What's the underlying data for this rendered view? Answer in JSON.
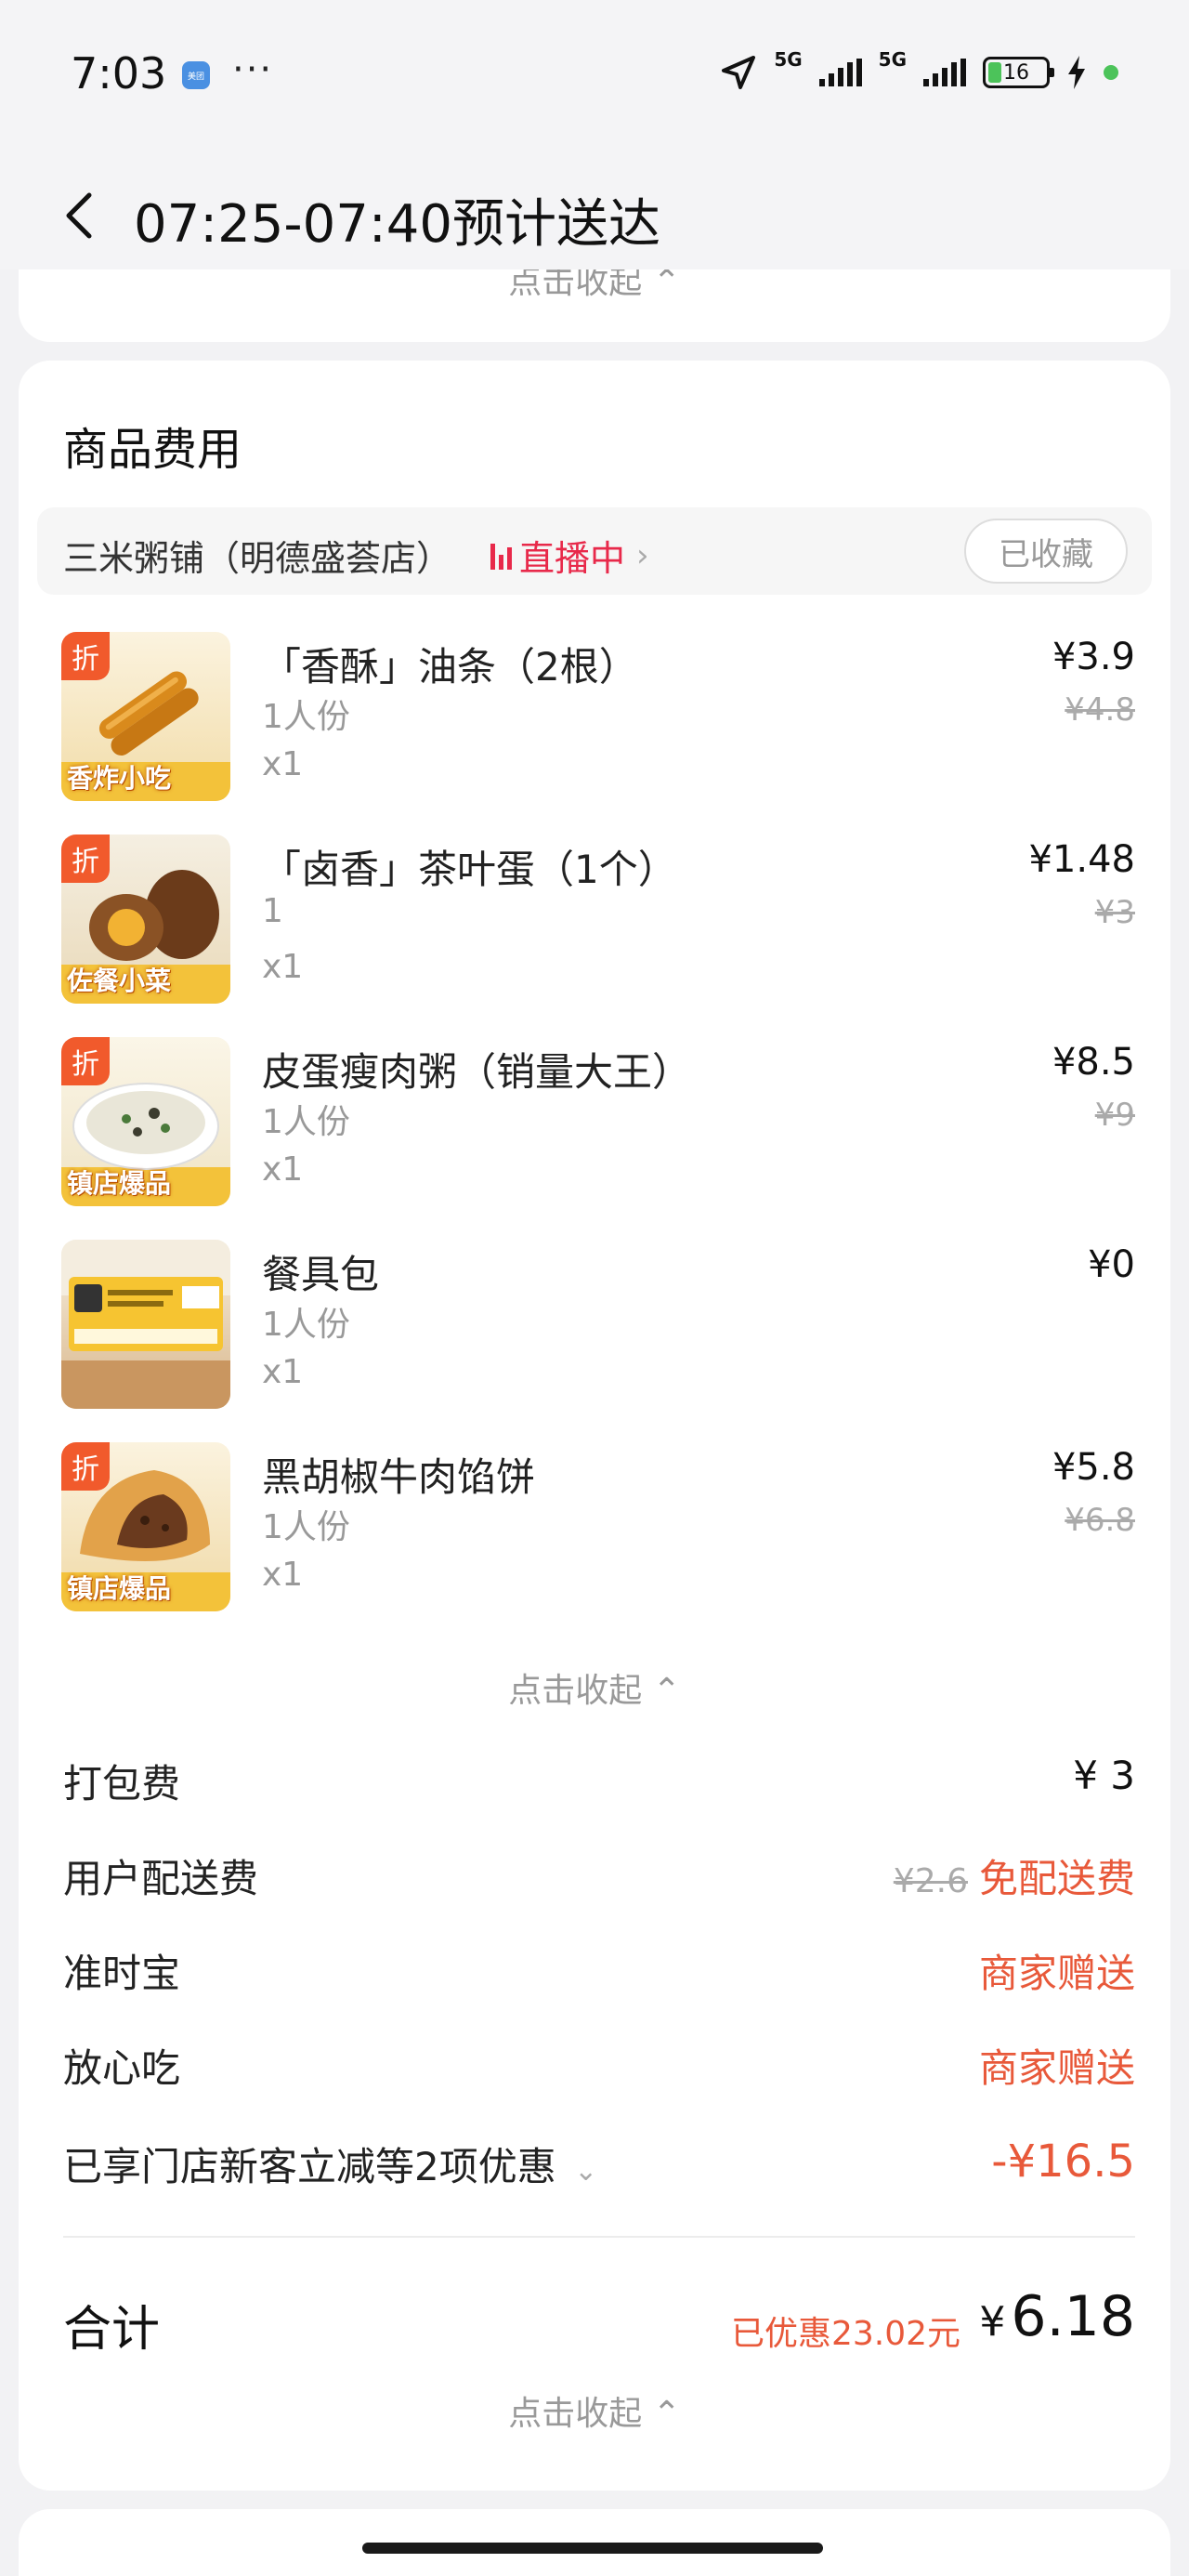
{
  "status_bar": {
    "time": "7:03",
    "app_badge": "美团",
    "more": "···",
    "net1": "5G",
    "net2": "5G",
    "battery": "16"
  },
  "header": {
    "title": "07:25-07:40预计送达"
  },
  "prev_section": {
    "collapse_label": "点击收起 ⌃"
  },
  "goods": {
    "section_title": "商品费用",
    "store": {
      "name": "三米粥铺（明德盛荟店）",
      "live_label": "直播中",
      "live_chevron": "›",
      "favorite_label": "已收藏"
    },
    "items": [
      {
        "name": "「香酥」油条（2根）",
        "spec": "1人份",
        "qty": "x1",
        "price": "¥3.9",
        "original_price": "¥4.8",
        "badge": "折",
        "thumb_tag": "香炸小吃"
      },
      {
        "name": "「卤香」茶叶蛋（1个）",
        "spec": "1",
        "qty": "x1",
        "price": "¥1.48",
        "original_price": "¥3",
        "badge": "折",
        "thumb_tag": "佐餐小菜"
      },
      {
        "name": "皮蛋瘦肉粥（销量大王）",
        "spec": "1人份",
        "qty": "x1",
        "price": "¥8.5",
        "original_price": "¥9",
        "badge": "折",
        "thumb_tag": "镇店爆品"
      },
      {
        "name": "餐具包",
        "spec": "1人份",
        "qty": "x1",
        "price": "¥0",
        "original_price": "",
        "badge": "",
        "thumb_tag": ""
      },
      {
        "name": "黑胡椒牛肉馅饼",
        "spec": "1人份",
        "qty": "x1",
        "price": "¥5.8",
        "original_price": "¥6.8",
        "badge": "折",
        "thumb_tag": "镇店爆品"
      }
    ],
    "collapse_label": "点击收起 ⌃"
  },
  "fees": {
    "packing": {
      "label": "打包费",
      "value": "¥ 3"
    },
    "delivery": {
      "label": "用户配送费",
      "original": "¥2.6",
      "value": "免配送费"
    },
    "ontime": {
      "label": "准时宝",
      "value": "商家赠送"
    },
    "safe_eat": {
      "label": "放心吃",
      "value": "商家赠送"
    },
    "discount": {
      "label": "已享门店新客立减等2项优惠",
      "chevron": "⌄",
      "value": "-¥16.5"
    }
  },
  "total": {
    "label": "合计",
    "saved": "已优惠23.02元",
    "currency": "¥",
    "amount": "6.18"
  },
  "footer": {
    "collapse_label": "点击收起 ⌃"
  },
  "colors": {
    "accent_red": "#e8593a",
    "live_red": "#e8294a",
    "discount_badge": "#f15a2c"
  }
}
